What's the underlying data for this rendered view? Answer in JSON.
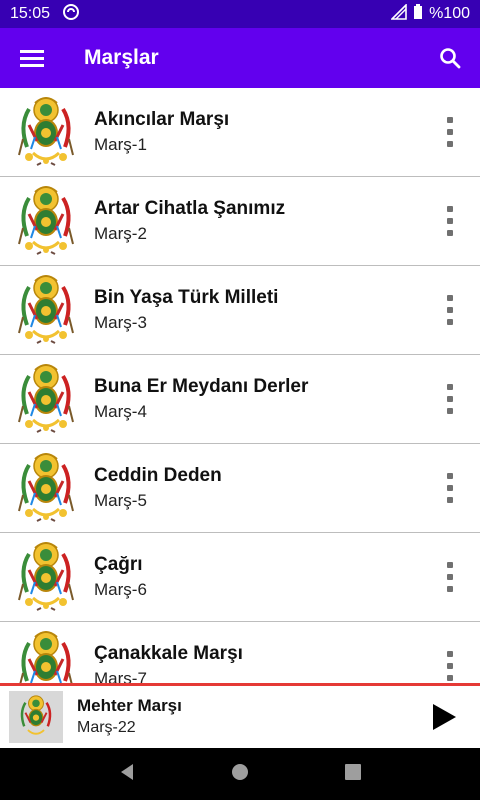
{
  "status": {
    "time": "15:05",
    "battery": "%100"
  },
  "appbar": {
    "title": "Marşlar"
  },
  "songs": [
    {
      "name": "Akıncılar Marşı",
      "sub": "Marş-1"
    },
    {
      "name": "Artar Cihatla Şanımız",
      "sub": "Marş-2"
    },
    {
      "name": "Bin Yaşa Türk Milleti",
      "sub": "Marş-3"
    },
    {
      "name": "Buna Er Meydanı Derler",
      "sub": "Marş-4"
    },
    {
      "name": "Ceddin Deden",
      "sub": "Marş-5"
    },
    {
      "name": "Çağrı",
      "sub": "Marş-6"
    },
    {
      "name": "Çanakkale Marşı",
      "sub": "Marş-7"
    }
  ],
  "player": {
    "name": "Mehter Marşı",
    "sub": "Marş-22"
  },
  "colors": {
    "statusbar": "#3700b3",
    "appbar": "#6200ee",
    "accent_line": "#e53935"
  },
  "icons": [
    "menu-icon",
    "search-icon",
    "more-vert-icon",
    "play-icon",
    "back-icon",
    "home-icon",
    "recents-icon",
    "ottoman-emblem"
  ]
}
